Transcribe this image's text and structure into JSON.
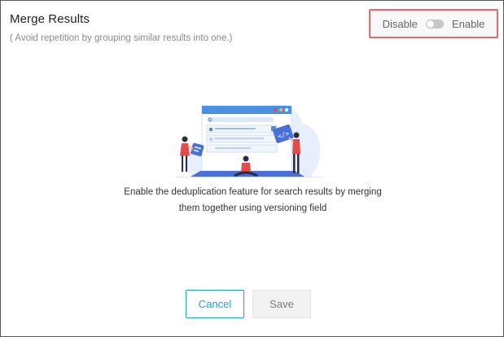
{
  "header": {
    "title": "Merge Results",
    "subtitle": "( Avoid repetition by grouping similar results into one.)"
  },
  "toggle": {
    "off_label": "Disable",
    "on_label": "Enable",
    "state": "disabled"
  },
  "illustration": {
    "icon": "search-deduplication-illustration",
    "code_glyph": "</>",
    "colors": {
      "accent": "#4a90e2",
      "cloud": "#e6effb",
      "person_red": "#e34a4a"
    }
  },
  "description": {
    "line1": "Enable the deduplication feature for search results by merging",
    "line2": "them together using versioning field"
  },
  "footer": {
    "cancel_label": "Cancel",
    "save_label": "Save"
  },
  "colors": {
    "highlight_border": "#e06a70",
    "primary": "#1f9fd8",
    "disabled_button": "#f2f2f2"
  }
}
